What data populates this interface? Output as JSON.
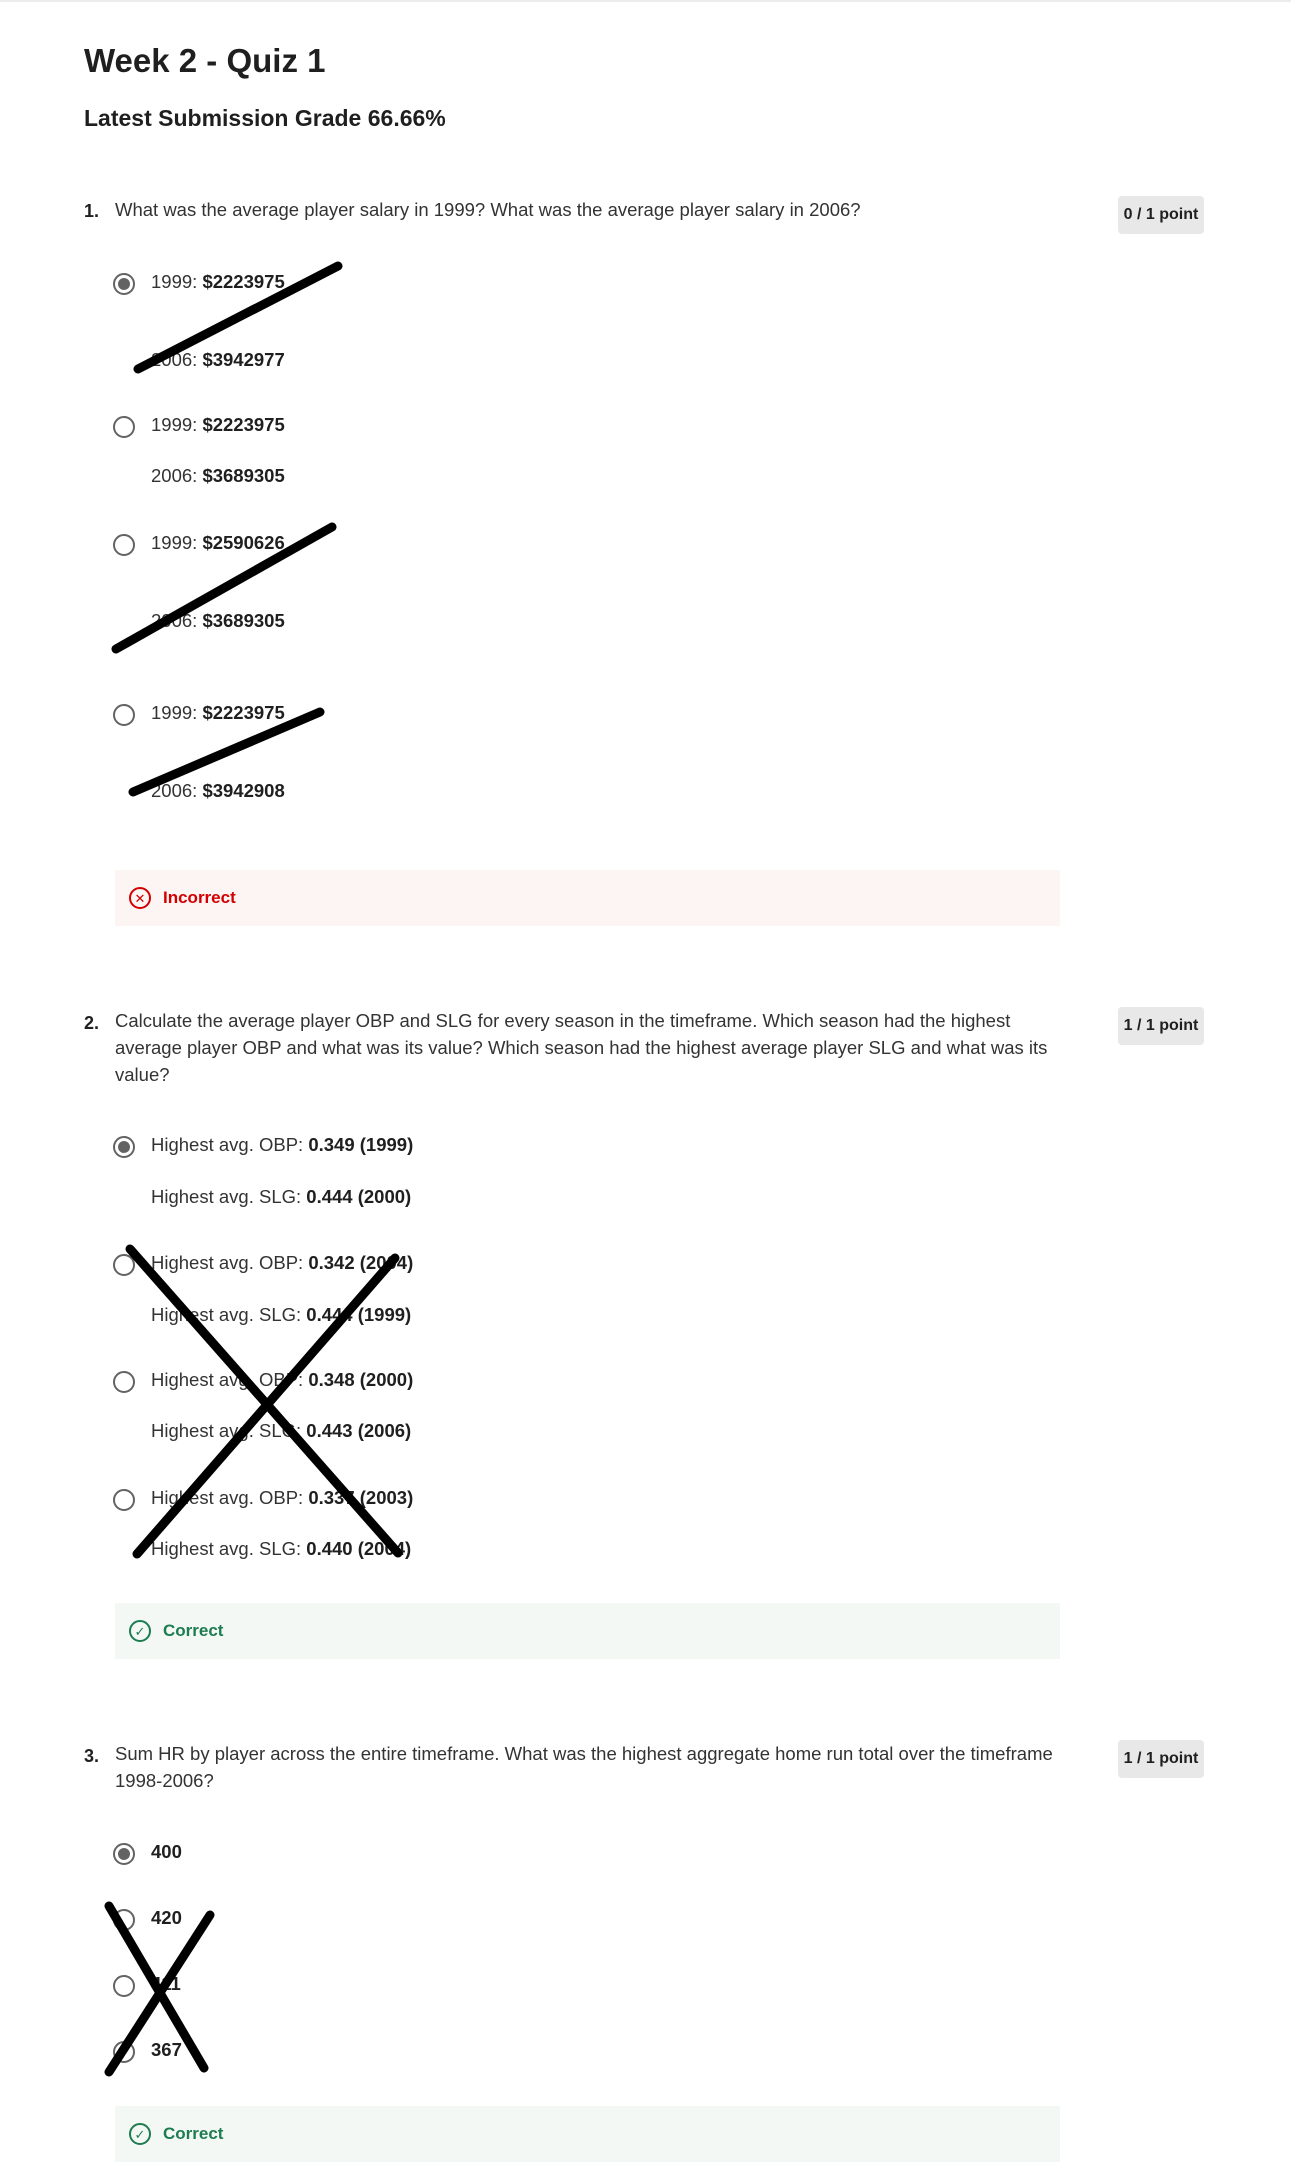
{
  "page": {
    "title": "Week 2 - Quiz 1",
    "grade": "Latest Submission Grade 66.66%"
  },
  "questions": [
    {
      "number": "1.",
      "text": "What was the average player salary in 1999?  What was the average player salary in 2006?",
      "points": "0 / 1 point",
      "options": [
        {
          "l1_label": "1999: ",
          "l1_value": "$2223975",
          "l2_label": "2006: ",
          "l2_value": "$3942977",
          "selected": true
        },
        {
          "l1_label": "1999: ",
          "l1_value": "$2223975",
          "l2_label": "2006: ",
          "l2_value": "$3689305",
          "selected": false
        },
        {
          "l1_label": "1999: ",
          "l1_value": "$2590626",
          "l2_label": "2006: ",
          "l2_value": "$3689305",
          "selected": false
        },
        {
          "l1_label": "1999: ",
          "l1_value": "$2223975",
          "l2_label": "2006: ",
          "l2_value": "$3942908",
          "selected": false
        }
      ],
      "feedback": "Incorrect",
      "feedback_icon": "x-circle-icon",
      "feedback_color": "#d30001"
    },
    {
      "number": "2.",
      "text_lines": [
        "Calculate the average player OBP and SLG for every season in the timeframe.  Which season had the highest",
        "average player OBP and what was its value?  Which season had the highest average player SLG and what was its",
        "value?"
      ],
      "points": "1 / 1 point",
      "options": [
        {
          "l1_label": "Highest avg. OBP:  ",
          "l1_value": "0.349 (1999)",
          "l2_label": "Highest avg. SLG: ",
          "l2_value": "0.444 (2000)",
          "selected": true
        },
        {
          "l1_label": "Highest avg. OBP:  ",
          "l1_value": "0.342 (2004)",
          "l2_label": "Highest avg. SLG: ",
          "l2_value": "0.444 (1999)",
          "selected": false
        },
        {
          "l1_label": "Highest avg. OBP:  ",
          "l1_value": "0.348 (2000)",
          "l2_label": "Highest avg. SLG: ",
          "l2_value": "0.443 (2006)",
          "selected": false
        },
        {
          "l1_label": "Highest avg. OBP:  ",
          "l1_value": "0.337 (2003)",
          "l2_label": "Highest avg. SLG: ",
          "l2_value": "0.440 (2004)",
          "selected": false
        }
      ],
      "feedback": "Correct",
      "feedback_icon": "check-circle-icon",
      "feedback_color": "#1d7c50"
    },
    {
      "number": "3.",
      "text_lines": [
        "Sum HR by player across the entire timeframe.  What was the highest aggregate home run total over the timeframe",
        "1998-2006?"
      ],
      "points": "1 / 1 point",
      "options": [
        {
          "value": "400",
          "selected": true
        },
        {
          "value": "420",
          "selected": false
        },
        {
          "value": "411",
          "selected": false
        },
        {
          "value": "367",
          "selected": false
        }
      ],
      "feedback": "Correct"
    }
  ],
  "annotation_color": "#000000"
}
